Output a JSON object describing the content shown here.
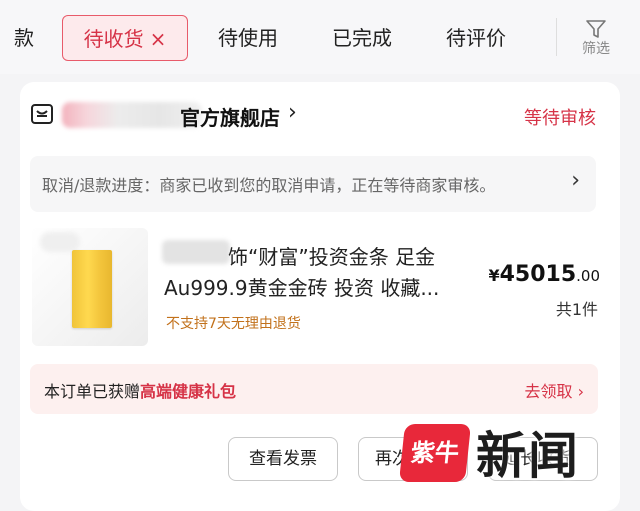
{
  "tabs": {
    "partial_label": "款",
    "active_label": "待收货",
    "active_close": "×",
    "items": [
      "待使用",
      "已完成",
      "待评价"
    ],
    "filter_label": "筛选"
  },
  "order": {
    "store_name": "官方旗舰店",
    "store_chevron": "›",
    "status": "等待审核",
    "progress_text": "取消/退款进度：商家已收到您的取消申请，正在等待商家审核。",
    "progress_chevron": "›",
    "product": {
      "title_line1": "饰“财富”投资金条 足金",
      "title_line2": "Au999.9黄金金砖 投资 收藏...",
      "return_policy": "不支持7天无理由退货",
      "price_symbol": "¥",
      "price_int": "45015",
      "price_dec": ".00",
      "quantity": "共1件"
    },
    "gift": {
      "prefix": "本订单已获赠",
      "highlight": "高端健康礼包",
      "action": "去领取 ›"
    },
    "buttons": {
      "invoice": "查看发票",
      "rebuy": "再次",
      "third": "延长收货"
    }
  },
  "watermark": {
    "badge": "紫牛",
    "text": "新闻"
  },
  "colors": {
    "accent": "#d63347",
    "gift_bg": "#fdf0ef",
    "return_policy": "#c2711b"
  }
}
